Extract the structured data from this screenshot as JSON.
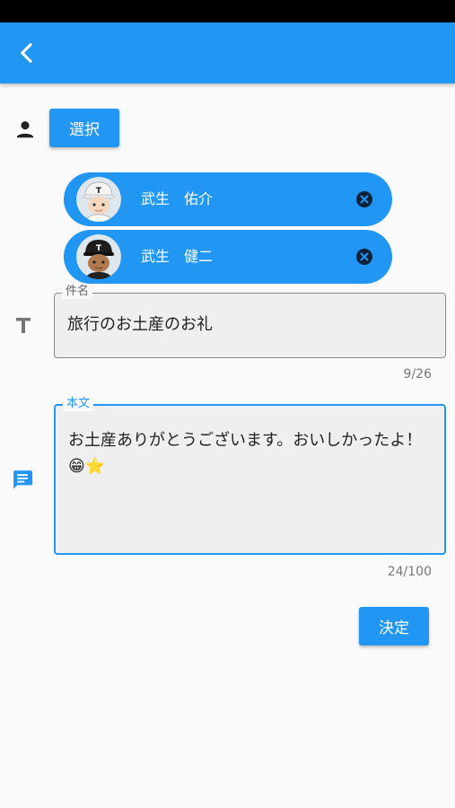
{
  "app_bar": {
    "back_icon": "chevron-left-icon",
    "color": "#2196f3"
  },
  "recipients": {
    "icon": "person-icon",
    "select_label": "選択",
    "chips": [
      {
        "name": "武生　佑介",
        "avatar_icon": "baseball-player-white-cap-avatar",
        "delete_icon": "cancel-circle-icon"
      },
      {
        "name": "武生　健二",
        "avatar_icon": "baseball-player-black-cap-avatar",
        "delete_icon": "cancel-circle-icon"
      }
    ]
  },
  "subject": {
    "icon": "text-t-icon",
    "label": "件名",
    "value": "旅行のお土産のお礼",
    "counter": "9/26"
  },
  "body": {
    "icon": "message-icon",
    "label": "本文",
    "value": "お土産ありがとうございます。おいしかったよ！😁⭐",
    "counter": "24/100"
  },
  "submit": {
    "label": "決定"
  }
}
